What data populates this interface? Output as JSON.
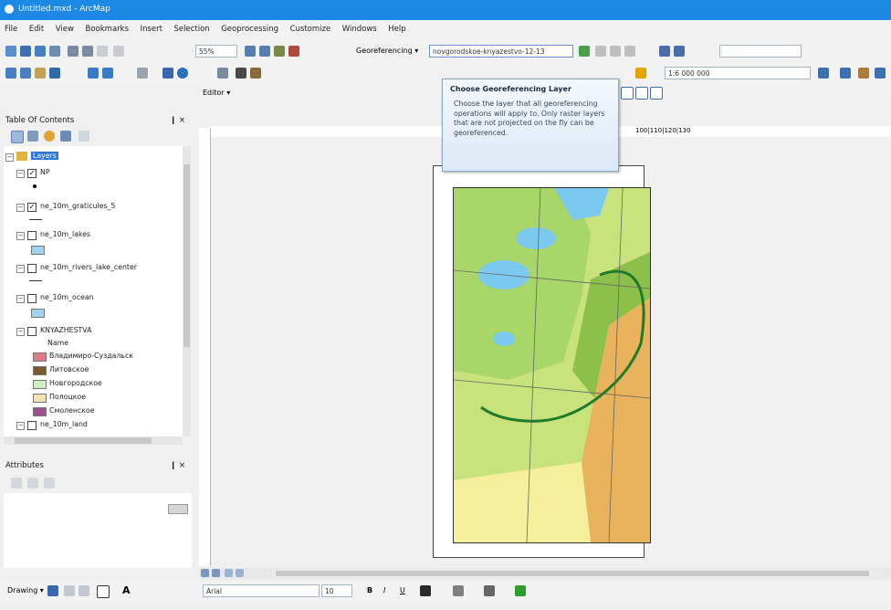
{
  "window": {
    "title": "Untitled.mxd - ArcMap"
  },
  "menu": [
    "File",
    "Edit",
    "View",
    "Bookmarks",
    "Insert",
    "Selection",
    "Geoprocessing",
    "Customize",
    "Windows",
    "Help"
  ],
  "toolbar1": {
    "zoom_value": "55%"
  },
  "georef": {
    "label": "Georeferencing ▾",
    "layer_value": "novgorodskoe-knyazestvo-12-13"
  },
  "toolbar2": {
    "scale_value": "1:6 000 000",
    "editor_label": "Editor ▾"
  },
  "tooltip": {
    "title": "Choose Georeferencing Layer",
    "body": "Choose the layer that all georeferencing operations will apply to. Only raster layers that are not projected on the fly can be georeferenced."
  },
  "toc": {
    "title": "Table Of Contents",
    "pin": "❙ ×",
    "layers_group": "Layers",
    "items": [
      {
        "name": "NP",
        "checked": true
      },
      {
        "name": "ne_10m_graticules_5",
        "checked": true
      },
      {
        "name": "ne_10m_lakes",
        "checked": false
      },
      {
        "name": "ne_10m_rivers_lake_center",
        "checked": false
      },
      {
        "name": "ne_10m_ocean",
        "checked": false
      },
      {
        "name": "KNYAZHESTVA",
        "checked": false
      },
      {
        "name": "ne_10m_land",
        "checked": false
      }
    ],
    "legend_heading": "Name",
    "legend": [
      {
        "label": "Владимиро-Суздальск",
        "color": "#e27a86"
      },
      {
        "label": "Литовское",
        "color": "#7a5a2a"
      },
      {
        "label": "Новгородское",
        "color": "#cfeec2"
      },
      {
        "label": "Полоцкое",
        "color": "#f3e2b0"
      },
      {
        "label": "Смоленское",
        "color": "#a24d8f"
      }
    ]
  },
  "attributes": {
    "title": "Attributes",
    "pin": "❙ ×"
  },
  "ruler": {
    "top_labels": "100|110|120|130"
  },
  "drawing": {
    "label": "Drawing ▾",
    "font": "Arial",
    "size": "10",
    "bold": "B",
    "italic": "I",
    "underline": "U",
    "text_a": "A"
  }
}
